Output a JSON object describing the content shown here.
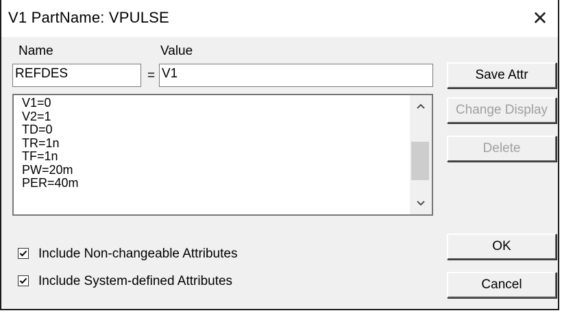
{
  "window": {
    "title": "V1   PartName: VPULSE",
    "close_glyph": "✕"
  },
  "labels": {
    "name": "Name",
    "value": "Value",
    "equals": "="
  },
  "fields": {
    "name_value": "REFDES",
    "value_value": "V1"
  },
  "attributes": {
    "items": [
      "V1=0",
      "V2=1",
      "TD=0",
      "TR=1n",
      "TF=1n",
      "PW=20m",
      "PER=40m"
    ],
    "scroll_up_icon": "chevron-up-icon",
    "scroll_down_icon": "chevron-down-icon"
  },
  "buttons": {
    "save_attr": "Save Attr",
    "change_display": "Change Display",
    "delete": "Delete",
    "ok": "OK",
    "cancel": "Cancel"
  },
  "checkboxes": [
    {
      "label": "Include Non-changeable Attributes",
      "checked": true
    },
    {
      "label": "Include System-defined Attributes",
      "checked": true
    }
  ],
  "colors": {
    "dialog_bg": "#f0f0f0",
    "titlebar_bg": "#ffffff",
    "disabled_text": "#a0a0a0"
  }
}
